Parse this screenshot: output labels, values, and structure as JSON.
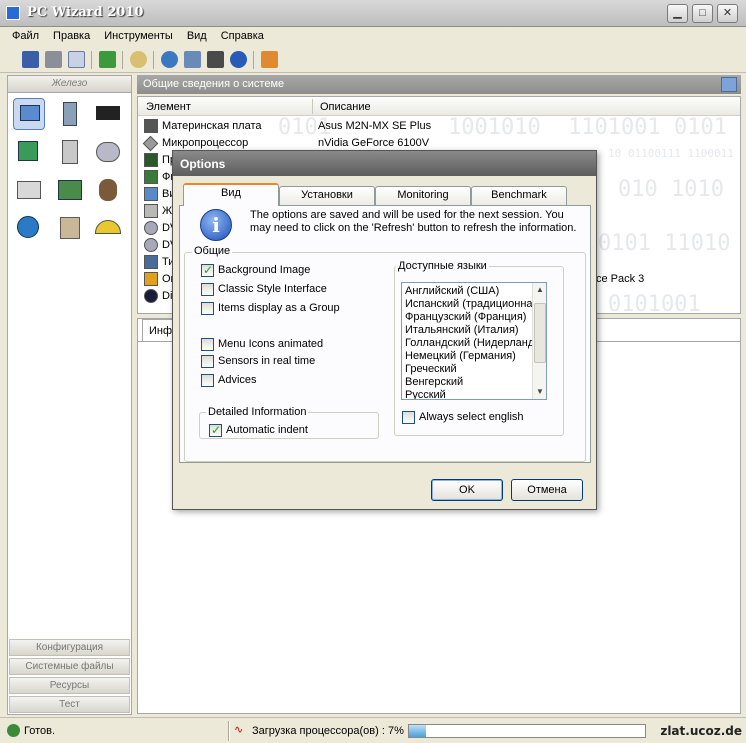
{
  "window": {
    "title": "PC Wizard 2010"
  },
  "menu": [
    "Файл",
    "Правка",
    "Инструменты",
    "Вид",
    "Справка"
  ],
  "left_panel": {
    "header": "Железо",
    "buttons": [
      "Конфигурация",
      "Системные файлы",
      "Ресурсы",
      "Тест"
    ]
  },
  "right_panel": {
    "header": "Общие сведения о системе",
    "columns": [
      "Элемент",
      "Описание"
    ],
    "rows": [
      {
        "element": "Материнская плата",
        "description": "Asus M2N-MX SE Plus"
      },
      {
        "element": "Микропроцессор",
        "description": "nVidia GeForce 6100V"
      },
      {
        "element": "Пр",
        "description": ""
      },
      {
        "element": "Фи",
        "description": ""
      },
      {
        "element": "Ви",
        "description": ""
      },
      {
        "element": "Же",
        "description": ""
      },
      {
        "element": "DV",
        "description": ""
      },
      {
        "element": "DV",
        "description": ""
      },
      {
        "element": "Ти",
        "description": ""
      },
      {
        "element": "Ог",
        "description": "vice Pack 3"
      },
      {
        "element": "Di",
        "description": ""
      }
    ],
    "binary_bg": [
      "0101",
      "1001010",
      "1101001 0101",
      "10 01100111 1100011",
      "010 1010",
      "0101 11010",
      "0101001"
    ],
    "lower_tab": "Инф"
  },
  "status": {
    "ready": "Готов.",
    "cpu_load": "Загрузка процессора(ов) : 7%",
    "cpu_percent": 7,
    "watermark": "zlat.ucoz.de"
  },
  "dialog": {
    "title": "Options",
    "tabs": [
      "Вид",
      "Установки",
      "Monitoring",
      "Benchmark"
    ],
    "active_tab": 0,
    "info": "The options are saved and will be used for the next session. You may need to click on the 'Refresh' button to refresh the information.",
    "general_group": "Общие",
    "options": [
      {
        "label": "Background Image",
        "checked": true
      },
      {
        "label": "Classic Style Interface",
        "checked": false
      },
      {
        "label": "Items display as a Group",
        "checked": false
      },
      {
        "label": "Menu Icons animated",
        "checked": false
      },
      {
        "label": "Sensors in real time",
        "checked": false
      },
      {
        "label": "Advices",
        "checked": false
      }
    ],
    "detailed_group": "Detailed Information",
    "auto_indent": {
      "label": "Automatic indent",
      "checked": true
    },
    "languages_label": "Доступные языки",
    "languages": [
      "Английский (США)",
      "Испанский (традиционна",
      "Французский (Франция)",
      "Итальянский (Италия)",
      "Голландский (Нидерланд",
      "Немецкий (Германия)",
      "Греческий",
      "Венгерский",
      "Русский"
    ],
    "always_english": {
      "label": "Always select english",
      "checked": false
    },
    "ok": "OK",
    "cancel": "Отмена"
  }
}
